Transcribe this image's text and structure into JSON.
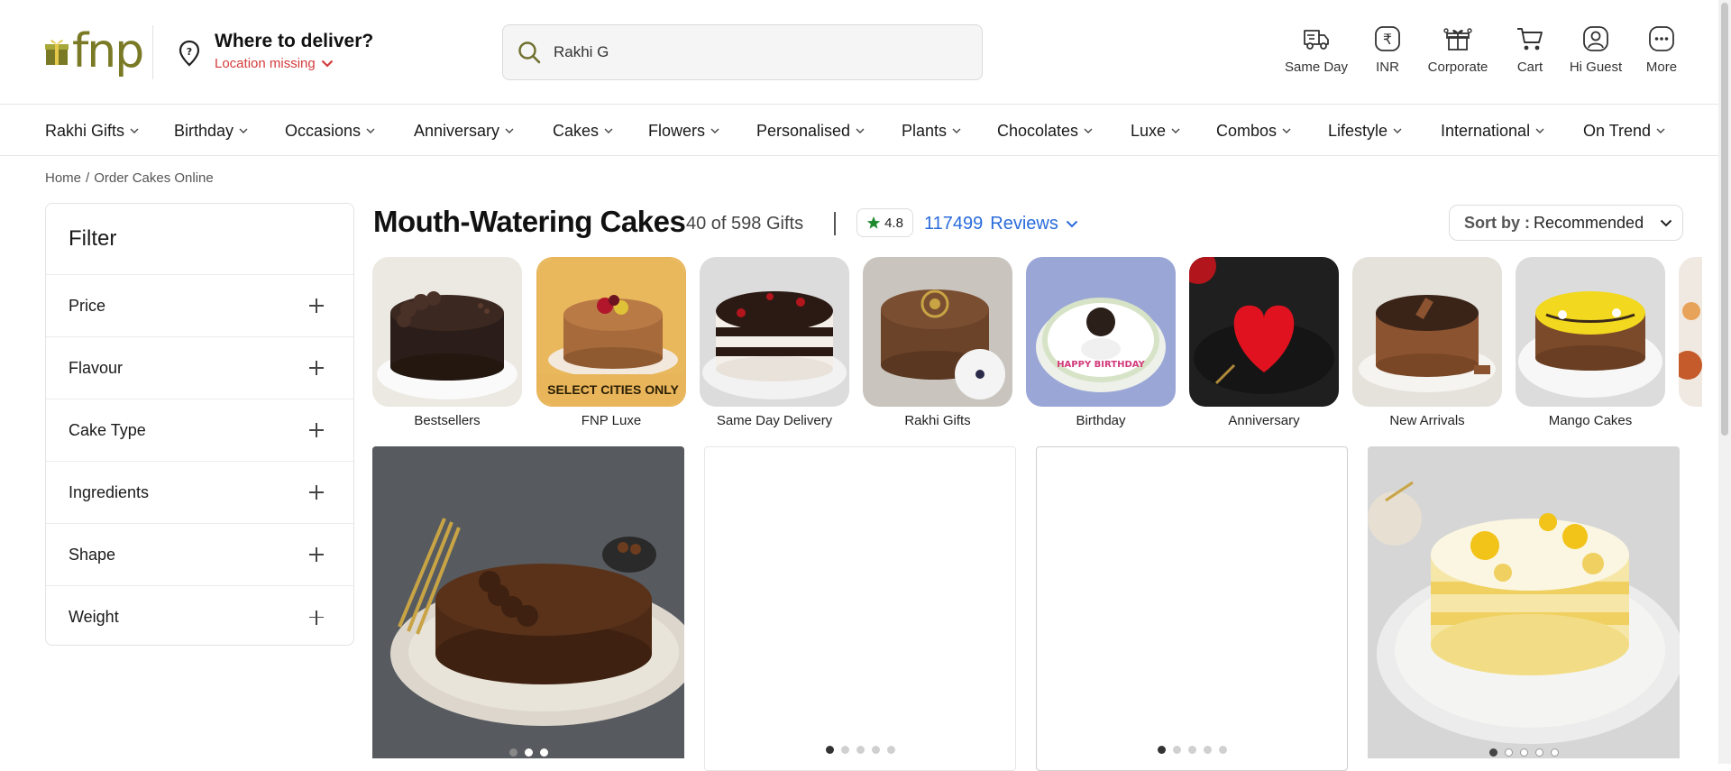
{
  "header": {
    "logo_text": "fnp",
    "deliver_title": "Where to deliver?",
    "deliver_sub": "Location missing",
    "search_value": "Rakhi G",
    "utilities": [
      {
        "label": "Same Day",
        "icon": "truck-icon"
      },
      {
        "label": "INR",
        "icon": "rupee-icon"
      },
      {
        "label": "Corporate",
        "icon": "gift-group-icon"
      },
      {
        "label": "Cart",
        "icon": "cart-icon"
      },
      {
        "label": "Hi Guest",
        "icon": "user-icon"
      },
      {
        "label": "More",
        "icon": "more-icon"
      }
    ]
  },
  "nav": {
    "items": [
      "Rakhi Gifts",
      "Birthday",
      "Occasions",
      "Anniversary",
      "Cakes",
      "Flowers",
      "Personalised",
      "Plants",
      "Chocolates",
      "Luxe",
      "Combos",
      "Lifestyle",
      "International",
      "On Trend"
    ]
  },
  "breadcrumb": {
    "home": "Home",
    "sep": "/",
    "current": "Order Cakes Online"
  },
  "filter": {
    "title": "Filter",
    "items": [
      "Price",
      "Flavour",
      "Cake Type",
      "Ingredients",
      "Shape",
      "Weight"
    ]
  },
  "listing": {
    "title": "Mouth-Watering Cakes",
    "count": "40 of 598 Gifts",
    "rating": "4.8",
    "reviews_count": "117499",
    "reviews_label": "Reviews",
    "sort_key": "Sort by :",
    "sort_value": "Recommended"
  },
  "categories": [
    {
      "label": "Bestsellers"
    },
    {
      "label": "FNP Luxe",
      "badge": "SELECT CITIES ONLY"
    },
    {
      "label": "Same Day Delivery"
    },
    {
      "label": "Rakhi Gifts"
    },
    {
      "label": "Birthday",
      "cake_text": "HAPPY BIRTHDAY"
    },
    {
      "label": "Anniversary"
    },
    {
      "label": "New Arrivals"
    },
    {
      "label": "Mango Cakes"
    }
  ],
  "colors": {
    "brand": "#7a7a26",
    "link": "#2a6bdb",
    "alert": "#d43b3b",
    "rating_star": "#1e8a2e"
  }
}
